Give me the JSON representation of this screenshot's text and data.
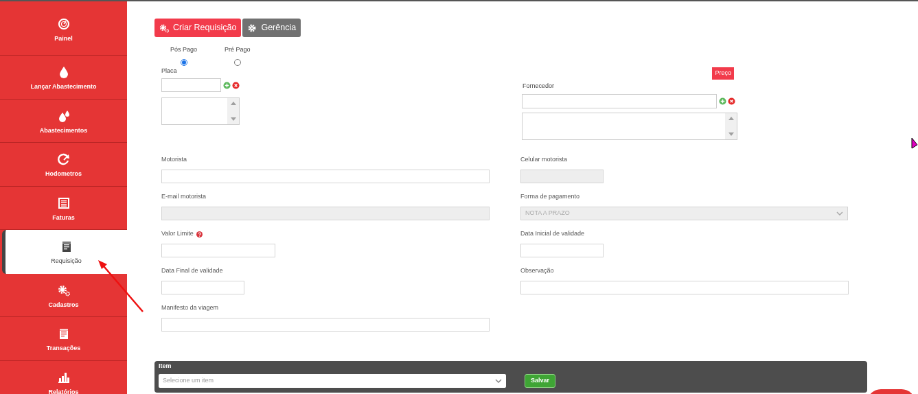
{
  "sidebar": {
    "items": [
      {
        "label": "Painel",
        "selected": false
      },
      {
        "label": "Lançar Abastecimento",
        "selected": false
      },
      {
        "label": "Abastecimentos",
        "selected": false
      },
      {
        "label": "Hodometros",
        "selected": false
      },
      {
        "label": "Faturas",
        "selected": false
      },
      {
        "label": "Requisição",
        "selected": true
      },
      {
        "label": "Cadastros",
        "selected": false
      },
      {
        "label": "Transações",
        "selected": false
      },
      {
        "label": "Relatórios",
        "selected": false
      }
    ]
  },
  "toolbar": {
    "buttons": [
      {
        "label": "Criar Requisição",
        "kind": "primary"
      },
      {
        "label": "Gerência",
        "kind": "secondary"
      }
    ]
  },
  "payment_type": {
    "options": [
      {
        "label": "Pós Pago",
        "selected": true
      },
      {
        "label": "Pré Pago",
        "selected": false
      }
    ]
  },
  "placa": {
    "label": "Placa"
  },
  "fornecedor": {
    "label": "Fornecedor",
    "badge": "Preço"
  },
  "rows": [
    [
      {
        "label": "Motorista",
        "kind": "wide",
        "disabled": false
      },
      {
        "label": "Celular motorista",
        "kind": "short",
        "disabled": true
      }
    ],
    [
      {
        "label": "E-mail motorista",
        "kind": "wide",
        "disabled": true
      },
      {
        "label": "Forma de pagamento",
        "kind": "select",
        "disabled": true,
        "value": "NOTA A PRAZO"
      }
    ],
    [
      {
        "label": "Valor Limite",
        "kind": "medium",
        "disabled": false,
        "help": true
      },
      {
        "label": "Data Inicial de validade",
        "kind": "short",
        "disabled": false
      }
    ],
    [
      {
        "label": "Data Final de validade",
        "kind": "short",
        "disabled": false
      },
      {
        "label": "Observação",
        "kind": "wide",
        "disabled": false
      }
    ],
    [
      {
        "label": "Manifesto da viagem",
        "kind": "wide",
        "disabled": false
      }
    ]
  ],
  "item_bar": {
    "label": "Item",
    "placeholder": "Selecione um item",
    "button": "Salvar"
  }
}
